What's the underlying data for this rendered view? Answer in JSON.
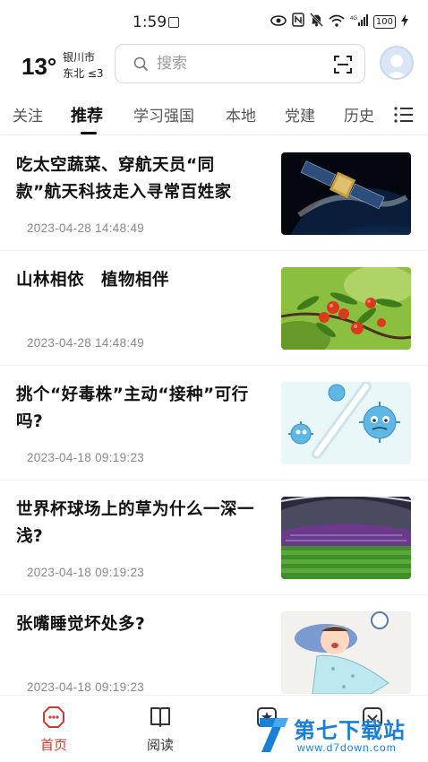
{
  "status_bar": {
    "time": "1:59",
    "battery": "100",
    "network": "4G"
  },
  "header": {
    "temperature": "13°",
    "city": "银川市",
    "wind": "东北 ≤3",
    "search_placeholder": "搜索"
  },
  "tabs": [
    {
      "label": "关注"
    },
    {
      "label": "推荐"
    },
    {
      "label": "学习强国"
    },
    {
      "label": "本地"
    },
    {
      "label": "党建"
    },
    {
      "label": "历史"
    }
  ],
  "active_tab": "推荐",
  "articles": [
    {
      "title": "吃太空蔬菜、穿航天员“同款”航天科技走入寻常百姓家",
      "time": "2023-04-28 14:48:49",
      "thumb": "satellite-earth"
    },
    {
      "title": "山林相依　植物相伴",
      "time": "2023-04-28 14:48:49",
      "thumb": "red-berries"
    },
    {
      "title": "挑个“好毒株”主动“接种”可行吗?",
      "time": "2023-04-18 09:19:23",
      "thumb": "virus-cartoon"
    },
    {
      "title": "世界杯球场上的草为什么一深一浅?",
      "time": "2023-04-18 09:19:23",
      "thumb": "football-stadium"
    },
    {
      "title": "张嘴睡觉坏处多?",
      "time": "2023-04-18 09:19:23",
      "thumb": "sleeping-child"
    }
  ],
  "bottom_nav": [
    {
      "label": "首页",
      "icon": "home-icon",
      "active": true
    },
    {
      "label": "阅读",
      "icon": "book-icon",
      "active": false
    },
    {
      "label": "",
      "icon": "star-icon",
      "active": false
    },
    {
      "label": "",
      "icon": "life-icon",
      "active": false
    }
  ],
  "watermark": {
    "text": "第七下载站",
    "sub": "www.d7down.com"
  },
  "colors": {
    "accent": "#d43a2c",
    "watermark": "#1a7fd6"
  }
}
